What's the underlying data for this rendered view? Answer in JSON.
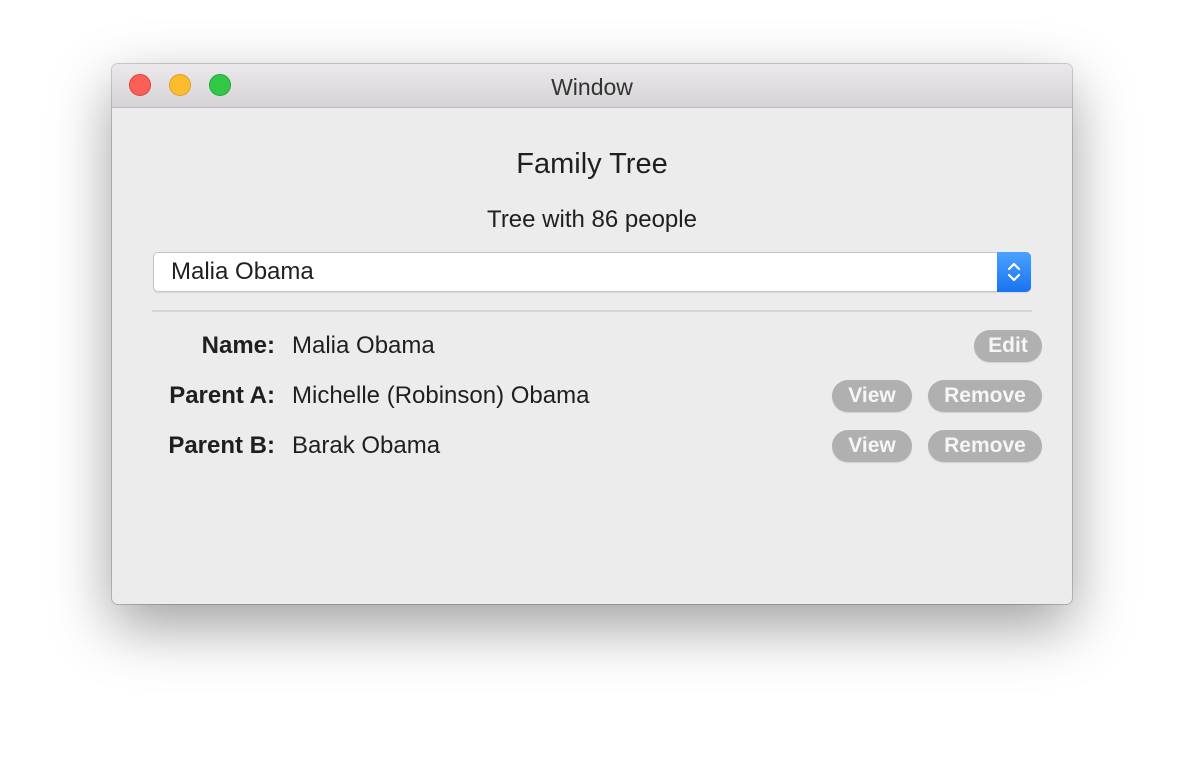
{
  "window": {
    "title": "Window"
  },
  "main": {
    "heading": "Family Tree",
    "subheading": "Tree with 86 people",
    "person_select": {
      "selected": "Malia Obama",
      "icon": "chevron-up-down-icon"
    }
  },
  "details": {
    "name": {
      "label": "Name:",
      "value": "Malia Obama",
      "edit_label": "Edit"
    },
    "parent_a": {
      "label": "Parent A:",
      "value": "Michelle (Robinson) Obama",
      "view_label": "View",
      "remove_label": "Remove"
    },
    "parent_b": {
      "label": "Parent B:",
      "value": "Barak Obama",
      "view_label": "View",
      "remove_label": "Remove"
    }
  },
  "colors": {
    "accent": "#1a73f0",
    "button_disabled": "#b0b0b0",
    "close": "#fc5f57",
    "minimize": "#fdbc2e",
    "maximize": "#33c748"
  }
}
